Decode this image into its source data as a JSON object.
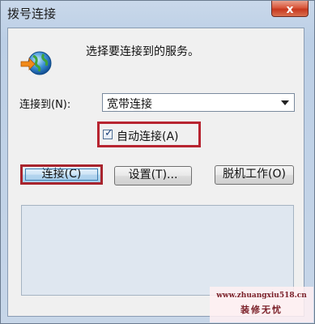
{
  "window": {
    "title": "拨号连接",
    "close_symbol": "x"
  },
  "dialog": {
    "prompt": "选择要连接到的服务。",
    "connect_to_label": "连接到(N):",
    "connection_selected": "宽带连接",
    "auto_connect_label": "自动连接(A)",
    "auto_connect_checked": true,
    "buttons": {
      "connect": "连接(C)",
      "settings": "设置(T)...",
      "offline": "脱机工作(O)"
    }
  },
  "watermark": {
    "url": "www.zhuangxiu518.cn",
    "name": "装修无忧"
  },
  "colors": {
    "highlight_border": "#b72430",
    "close_button": "#d9573c",
    "client_background": "#f0f0f0"
  },
  "icons": {
    "dialup": "globe-with-arrow-icon",
    "dropdown": "chevron-down-icon",
    "close": "close-icon"
  }
}
